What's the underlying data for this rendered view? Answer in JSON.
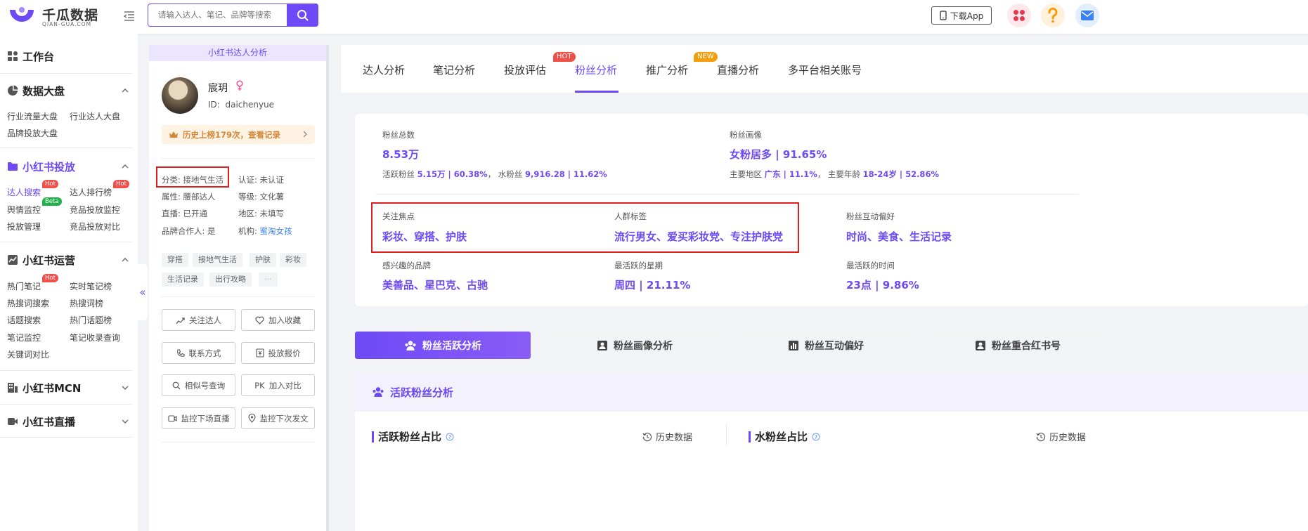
{
  "header": {
    "logo_cn": "千瓜数据",
    "logo_en": "QIAN-GUA.COM",
    "search_placeholder": "请输入达人、笔记、品牌等搜索",
    "download_label": "下载App"
  },
  "sidebar": {
    "workbench": "工作台",
    "groups": [
      {
        "title": "数据大盘",
        "links": [
          "行业流量大盘",
          "行业达人大盘",
          "品牌投放大盘"
        ]
      },
      {
        "title": "小红书投放",
        "links": [
          "达人搜索",
          "达人排行榜",
          "舆情监控",
          "竞品投放监控",
          "投放管理",
          "竞品投放对比"
        ]
      },
      {
        "title": "小红书运营",
        "links": [
          "热门笔记",
          "实时笔记榜",
          "热搜词搜索",
          "热搜词榜",
          "话题搜索",
          "热门话题榜",
          "笔记监控",
          "笔记收录查询",
          "关键词对比"
        ]
      },
      {
        "title": "小红书MCN"
      },
      {
        "title": "小红书直播"
      }
    ],
    "tags": {
      "hot": "Hot",
      "beta": "Beta"
    },
    "collapse": "«"
  },
  "profile": {
    "section_title": "小红书达人分析",
    "name": "宸玥",
    "id_label": "ID:",
    "id_value": "daichenyue",
    "banner": "历史上榜179次，查看记录",
    "attrs": {
      "category": "分类: 接地气生活",
      "cert": "认证: 未认证",
      "attribute": "属性: 腰部达人",
      "level": "等级: 文化薯",
      "live": "直播: 已开通",
      "region": "地区: 未填写",
      "brand_partner": "品牌合作人: 是",
      "org_label": "机构: ",
      "org_value": "蜜淘女孩"
    },
    "tags": [
      "穿搭",
      "接地气生活",
      "护肤",
      "彩妆",
      "生活记录",
      "出行攻略",
      "···"
    ],
    "buttons": [
      "关注达人",
      "加入收藏",
      "联系方式",
      "投放报价",
      "相似号查询",
      "加入对比",
      "监控下场直播",
      "监控下次发文"
    ],
    "pk_prefix": "PK"
  },
  "tabs": {
    "items": [
      "达人分析",
      "笔记分析",
      "投放评估",
      "粉丝分析",
      "推广分析",
      "直播分析",
      "多平台相关账号"
    ],
    "active_index": 3,
    "badge_hot": "HOT",
    "badge_new": "NEW"
  },
  "stats": {
    "fans_total_label": "粉丝总数",
    "fans_total_value": "8.53万",
    "active_fans_label": "活跃粉丝",
    "active_fans_value": "5.15万 | 60.38%",
    "sep": "，",
    "water_fans_label": "水粉丝",
    "water_fans_value": "9,916.28 | 11.62%",
    "portrait_label": "粉丝画像",
    "portrait_value": "女粉居多 | 91.65%",
    "region_label": "主要地区",
    "region_value": "广东 | 11.1%",
    "age_label": "主要年龄",
    "age_value": "18-24岁 | 52.86%",
    "focus_label": "关注焦点",
    "focus_value": "彩妆、穿搭、护肤",
    "crowd_label": "人群标签",
    "crowd_value": "流行男女、爱买彩妆党、专注护肤党",
    "interaction_label": "粉丝互动偏好",
    "interaction_value": "时尚、美食、生活记录",
    "brand_label": "感兴趣的品牌",
    "brand_value": "美善品、星巴克、古驰",
    "weekday_label": "最活跃的星期",
    "weekday_value": "周四 | 21.11%",
    "time_label": "最活跃的时间",
    "time_value": "23点 | 9.86%"
  },
  "subtabs": [
    "粉丝活跃分析",
    "粉丝画像分析",
    "粉丝互动偏好",
    "粉丝重合红书号"
  ],
  "panel": {
    "title": "活跃粉丝分析",
    "left_title": "活跃粉丝占比",
    "right_title": "水粉丝占比",
    "history_label": "历史数据"
  },
  "colors": {
    "accent": "#6d4af5",
    "highlight": "#e11d1d",
    "hot": "#f1504a",
    "new": "#f59e0b"
  }
}
